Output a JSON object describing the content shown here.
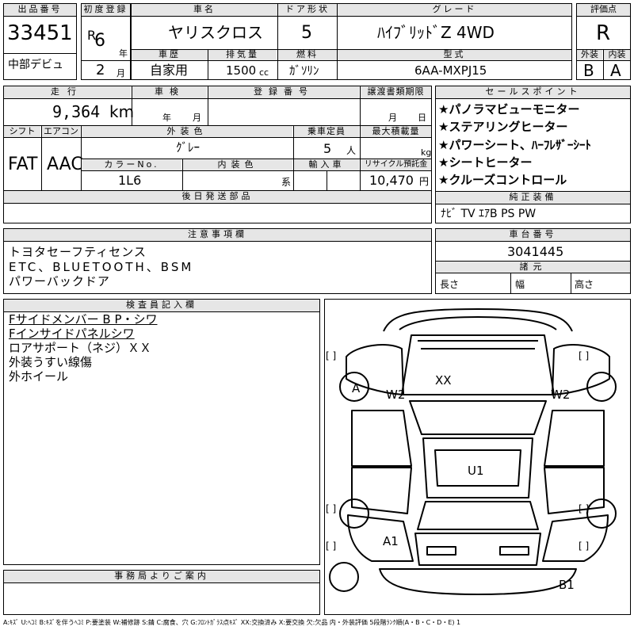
{
  "header": {
    "lot_no_label": "出品番号",
    "lot_no": "33451",
    "debut_label": "中部デビュ",
    "reg_label": "初度登録",
    "era": "R",
    "reg_year": "6",
    "year_unit": "年",
    "reg_month": "2",
    "month_unit": "月",
    "car_name_label": "車名",
    "car_name": "ヤリスクロス",
    "history_label": "車歴",
    "history": "自家用",
    "displacement_label": "排気量",
    "displacement": "1500",
    "cc_unit": "cc",
    "doors_label": "ドア形状",
    "doors": "5",
    "fuel_label": "燃料",
    "fuel": "ｶﾞｿﾘﾝ",
    "grade_label": "グレード",
    "grade": "ﾊｲﾌﾞﾘｯﾄﾞZ 4WD",
    "model_label": "型式",
    "model": "6AA-MXPJ15",
    "score_label": "評価点",
    "score": "R",
    "exterior_label": "外装",
    "exterior": "B",
    "interior_label": "内装",
    "interior": "A"
  },
  "row2": {
    "mileage_label": "走行",
    "mileage": "9,364",
    "km_unit": "km",
    "inspection_label": "車検",
    "insp_year_unit": "年",
    "insp_month_unit": "月",
    "plate_label": "登録番号",
    "transfer_label": "譲渡書類期限",
    "transfer_month_unit": "月",
    "transfer_day_unit": "日",
    "shift_label": "シフト",
    "shift": "FAT",
    "ac_label": "エアコン",
    "ac": "AAC",
    "color_label": "外装色",
    "color": "ｸﾞﾚｰ",
    "capacity_label": "乗車定員",
    "capacity": "5",
    "capacity_unit": "人",
    "load_label": "最大積載量",
    "load_unit": "kg",
    "color_no_label": "カラーNo.",
    "color_no": "1L6",
    "int_color_label": "内装色",
    "int_color_unit": "系",
    "import_label": "輸入車",
    "recycle_label": "リサイクル預託金",
    "recycle": "10,470",
    "recycle_unit": "円",
    "post_parts_label": "後日発送部品"
  },
  "sales": {
    "label": "セールスポイント",
    "items": [
      "★パノラマビューモニター",
      "★ステアリングヒーター",
      "★パワーシート、ﾊｰﾌﾚｻﾞｰｼｰﾄ",
      "★シートヒーター",
      "★クルーズコントロール"
    ]
  },
  "equipment": {
    "label": "純正装備",
    "value": "ﾅﾋﾞ TV ｴｱB PS PW"
  },
  "notes": {
    "label": "注意事項欄",
    "lines": [
      "トヨタセーフティセンス",
      "ETC、BLUETOOTH、BSM",
      "パワーバックドア"
    ]
  },
  "chassis": {
    "label": "車台番号",
    "value": "3041445",
    "dims_label": "諸元",
    "length_label": "長さ",
    "width_label": "幅",
    "height_label": "高さ"
  },
  "inspector": {
    "label": "検査員記入欄",
    "lines": [
      "Fサイドメンバー B P・シワ",
      "Fインサイドパネルシワ",
      "ロアサポート（ネジ）ＸＸ",
      "外装うすい線傷",
      "外ホイール"
    ]
  },
  "diagram": {
    "marks": [
      "XX",
      "A",
      "W2",
      "W2",
      "U1",
      "A1",
      "B1"
    ],
    "bracket": "[      ]"
  },
  "office": {
    "label": "事務局よりご案内"
  },
  "legend": "A:ｷｽﾞ U:ﾍｺﾐ B:ｷｽﾞを伴うﾍｺﾐ P:要塗装 W:補修跡 S:錆 C:腐食、穴 G:ﾌﾛﾝﾄｶﾞﾗｽ点ｷｽﾞ XX:交換済み X:要交換 欠:欠品 内・外装評価 5段階ﾗﾝｸ順(A・B・C・D・E) 1"
}
